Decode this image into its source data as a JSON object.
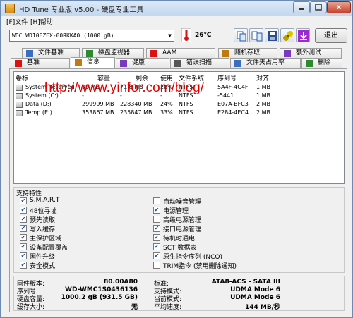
{
  "window": {
    "title": "HD Tune 专业版 v5.00 - 硬盘专业工具",
    "close_label": "x"
  },
  "menu": {
    "file": "[F]文件",
    "help": "[H]帮助"
  },
  "toolbar": {
    "drive": "WDC WD10EZEX-00RKKA0      (1000 gB)",
    "temperature": "26℃",
    "exit_label": "退出"
  },
  "tabs_top": [
    {
      "label": "文件基准",
      "icon": "file-benchmark-icon"
    },
    {
      "label": "磁盘监视器",
      "icon": "disk-monitor-icon"
    },
    {
      "label": "AAM",
      "icon": "aam-speaker-icon"
    },
    {
      "label": "随机存取",
      "icon": "random-access-icon"
    },
    {
      "label": "额外测试",
      "icon": "extra-tests-icon"
    }
  ],
  "tabs_bottom": [
    {
      "label": "基准",
      "icon": "benchmark-icon"
    },
    {
      "label": "信息",
      "icon": "info-icon"
    },
    {
      "label": "健康",
      "icon": "health-cross-icon"
    },
    {
      "label": "错误扫描",
      "icon": "error-scan-icon"
    },
    {
      "label": "文件夹占用率",
      "icon": "folder-usage-icon"
    },
    {
      "label": "删除",
      "icon": "erase-icon"
    }
  ],
  "partitions": {
    "columns": [
      "卷标",
      "容量",
      "剩余",
      "使用",
      "文件系统",
      "序列号",
      "对齐"
    ],
    "rows": [
      [
        "System Reserved",
        "99 MB",
        "71.8 MB",
        "28%",
        "NTFS",
        "5A4F-4C4F",
        "1 MB"
      ],
      [
        "System (C:)",
        "-",
        "-",
        "-",
        "NTFS",
        "-5441",
        "1 MB"
      ],
      [
        "Data (D:)",
        "299999 MB",
        "228340 MB",
        "24%",
        "NTFS",
        "E07A-BFC3",
        "2 MB"
      ],
      [
        "Temp (E:)",
        "353867 MB",
        "235847 MB",
        "33%",
        "NTFS",
        "E284-4EC4",
        "2 MB"
      ]
    ]
  },
  "watermark": "http://www.yinfor.com/blog/",
  "features": {
    "title": "支持特性",
    "left": [
      {
        "label": "S.M.A.R.T",
        "checked": true
      },
      {
        "label": "48位寻址",
        "checked": true
      },
      {
        "label": "预先读取",
        "checked": true
      },
      {
        "label": "写入缓存",
        "checked": true
      },
      {
        "label": "主保护区域",
        "checked": true
      },
      {
        "label": "设备配置覆盖",
        "checked": true
      },
      {
        "label": "固件升级",
        "checked": true
      },
      {
        "label": "安全模式",
        "checked": true
      }
    ],
    "right": [
      {
        "label": "自动噪音管理",
        "checked": false
      },
      {
        "label": "电源管理",
        "checked": true
      },
      {
        "label": "高级电源管理",
        "checked": false
      },
      {
        "label": "接口电源管理",
        "checked": true
      },
      {
        "label": "待机时通电",
        "checked": true
      },
      {
        "label": "SCT 数据表",
        "checked": true
      },
      {
        "label": "原生指令序列 (NCQ)",
        "checked": true
      },
      {
        "label": "TRIM指令 (禁用删除通知)",
        "checked": false
      }
    ]
  },
  "info": {
    "left": [
      {
        "label": "固件版本:",
        "value": "80.00A80"
      },
      {
        "label": "序列号:",
        "value": "WD-WMC1S0436136"
      },
      {
        "label": "硬盘容量:",
        "value": "1000.2 gB (931.5 GB)"
      },
      {
        "label": "缓存大小:",
        "value": "无"
      }
    ],
    "right": [
      {
        "label": "标准:",
        "value": "ATA8-ACS - SATA III"
      },
      {
        "label": "支持模式:",
        "value": "UDMA Mode 6"
      },
      {
        "label": "当前模式:",
        "value": "UDMA Mode 6"
      },
      {
        "label": "平均速度:",
        "value": "144 MB/秒"
      }
    ]
  },
  "colors": {
    "watermark": "#e00000",
    "check": "#1a4a9c",
    "close_button": "#c8432b"
  }
}
